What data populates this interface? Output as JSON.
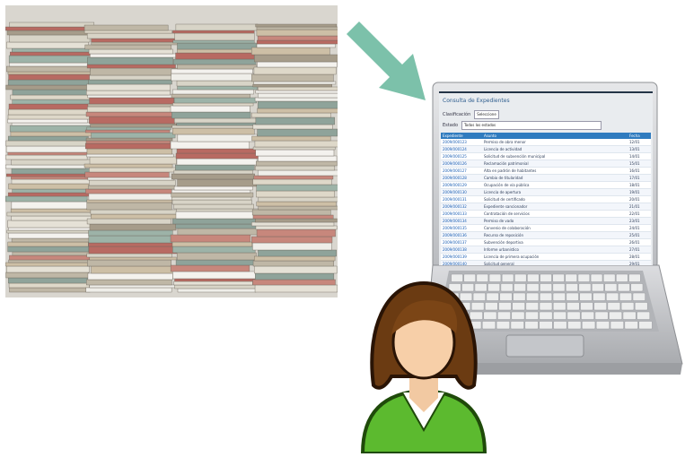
{
  "screen": {
    "title": "Consulta de Expedientes",
    "filter1_label": "Clasificación",
    "filter1_value": "Seleccione",
    "filter2_label": "Estado",
    "filter2_value": "Todos los estados",
    "columns": [
      "Expediente",
      "Asunto",
      "Fecha"
    ],
    "rows": [
      [
        "2009/000123",
        "Permiso de obra menor",
        "12/01"
      ],
      [
        "2009/000124",
        "Licencia de actividad",
        "13/01"
      ],
      [
        "2009/000125",
        "Solicitud de subvención municipal",
        "14/01"
      ],
      [
        "2009/000126",
        "Reclamación patrimonial",
        "15/01"
      ],
      [
        "2009/000127",
        "Alta en padrón de habitantes",
        "16/01"
      ],
      [
        "2009/000128",
        "Cambio de titularidad",
        "17/01"
      ],
      [
        "2009/000129",
        "Ocupación de vía pública",
        "18/01"
      ],
      [
        "2009/000130",
        "Licencia de apertura",
        "19/01"
      ],
      [
        "2009/000131",
        "Solicitud de certificado",
        "20/01"
      ],
      [
        "2009/000132",
        "Expediente sancionador",
        "21/01"
      ],
      [
        "2009/000133",
        "Contratación de servicios",
        "22/01"
      ],
      [
        "2009/000134",
        "Permiso de vado",
        "23/01"
      ],
      [
        "2009/000135",
        "Convenio de colaboración",
        "24/01"
      ],
      [
        "2009/000136",
        "Recurso de reposición",
        "25/01"
      ],
      [
        "2009/000137",
        "Subvención deportiva",
        "26/01"
      ],
      [
        "2009/000138",
        "Informe urbanístico",
        "27/01"
      ],
      [
        "2009/000139",
        "Licencia de primera ocupación",
        "28/01"
      ],
      [
        "2009/000140",
        "Solicitud general",
        "29/01"
      ]
    ]
  },
  "colors": {
    "arrow": "#7cc1aa",
    "laptop_body": "#c9cbcf",
    "screen_header": "#2f7bbf",
    "user_shirt": "#5cba2f",
    "user_hair": "#6b3b12"
  }
}
